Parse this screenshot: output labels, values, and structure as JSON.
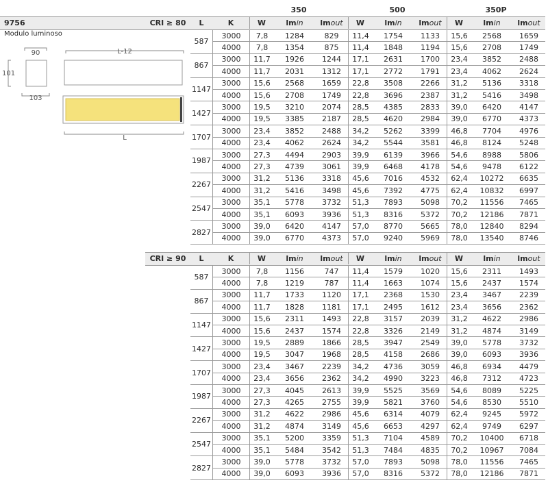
{
  "product_code": "9756",
  "subtitle": "Modulo luminoso",
  "drawing": {
    "width_label": "90",
    "height_label": "101",
    "depth_label": "103",
    "length_minus_label": "L-12",
    "length_label": "L",
    "fill_color": "#f5e27c"
  },
  "currents": [
    "350",
    "500",
    "350P"
  ],
  "table1": {
    "cri_label": "CRI ≥ 80",
    "col_L": "L",
    "col_K": "K",
    "sub_headers": [
      "W",
      "lm",
      "in",
      "lm",
      "out"
    ],
    "groups": [
      {
        "L": "587",
        "rows": [
          [
            "3000",
            "7,8",
            "1284",
            "829",
            "11,4",
            "1754",
            "1133",
            "15,6",
            "2568",
            "1659"
          ],
          [
            "4000",
            "7,8",
            "1354",
            "875",
            "11,4",
            "1848",
            "1194",
            "15,6",
            "2708",
            "1749"
          ]
        ]
      },
      {
        "L": "867",
        "rows": [
          [
            "3000",
            "11,7",
            "1926",
            "1244",
            "17,1",
            "2631",
            "1700",
            "23,4",
            "3852",
            "2488"
          ],
          [
            "4000",
            "11,7",
            "2031",
            "1312",
            "17,1",
            "2772",
            "1791",
            "23,4",
            "4062",
            "2624"
          ]
        ]
      },
      {
        "L": "1147",
        "rows": [
          [
            "3000",
            "15,6",
            "2568",
            "1659",
            "22,8",
            "3508",
            "2266",
            "31,2",
            "5136",
            "3318"
          ],
          [
            "4000",
            "15,6",
            "2708",
            "1749",
            "22,8",
            "3696",
            "2387",
            "31,2",
            "5416",
            "3498"
          ]
        ]
      },
      {
        "L": "1427",
        "rows": [
          [
            "3000",
            "19,5",
            "3210",
            "2074",
            "28,5",
            "4385",
            "2833",
            "39,0",
            "6420",
            "4147"
          ],
          [
            "4000",
            "19,5",
            "3385",
            "2187",
            "28,5",
            "4620",
            "2984",
            "39,0",
            "6770",
            "4373"
          ]
        ]
      },
      {
        "L": "1707",
        "rows": [
          [
            "3000",
            "23,4",
            "3852",
            "2488",
            "34,2",
            "5262",
            "3399",
            "46,8",
            "7704",
            "4976"
          ],
          [
            "4000",
            "23,4",
            "4062",
            "2624",
            "34,2",
            "5544",
            "3581",
            "46,8",
            "8124",
            "5248"
          ]
        ]
      },
      {
        "L": "1987",
        "rows": [
          [
            "3000",
            "27,3",
            "4494",
            "2903",
            "39,9",
            "6139",
            "3966",
            "54,6",
            "8988",
            "5806"
          ],
          [
            "4000",
            "27,3",
            "4739",
            "3061",
            "39,9",
            "6468",
            "4178",
            "54,6",
            "9478",
            "6122"
          ]
        ]
      },
      {
        "L": "2267",
        "rows": [
          [
            "3000",
            "31,2",
            "5136",
            "3318",
            "45,6",
            "7016",
            "4532",
            "62,4",
            "10272",
            "6635"
          ],
          [
            "4000",
            "31,2",
            "5416",
            "3498",
            "45,6",
            "7392",
            "4775",
            "62,4",
            "10832",
            "6997"
          ]
        ]
      },
      {
        "L": "2547",
        "rows": [
          [
            "3000",
            "35,1",
            "5778",
            "3732",
            "51,3",
            "7893",
            "5098",
            "70,2",
            "11556",
            "7465"
          ],
          [
            "4000",
            "35,1",
            "6093",
            "3936",
            "51,3",
            "8316",
            "5372",
            "70,2",
            "12186",
            "7871"
          ]
        ]
      },
      {
        "L": "2827",
        "rows": [
          [
            "3000",
            "39,0",
            "6420",
            "4147",
            "57,0",
            "8770",
            "5665",
            "78,0",
            "12840",
            "8294"
          ],
          [
            "4000",
            "39,0",
            "6770",
            "4373",
            "57,0",
            "9240",
            "5969",
            "78,0",
            "13540",
            "8746"
          ]
        ]
      }
    ]
  },
  "table2": {
    "cri_label": "CRI ≥ 90",
    "col_L": "L",
    "col_K": "K",
    "groups": [
      {
        "L": "587",
        "rows": [
          [
            "3000",
            "7,8",
            "1156",
            "747",
            "11,4",
            "1579",
            "1020",
            "15,6",
            "2311",
            "1493"
          ],
          [
            "4000",
            "7,8",
            "1219",
            "787",
            "11,4",
            "1663",
            "1074",
            "15,6",
            "2437",
            "1574"
          ]
        ]
      },
      {
        "L": "867",
        "rows": [
          [
            "3000",
            "11,7",
            "1733",
            "1120",
            "17,1",
            "2368",
            "1530",
            "23,4",
            "3467",
            "2239"
          ],
          [
            "4000",
            "11,7",
            "1828",
            "1181",
            "17,1",
            "2495",
            "1612",
            "23,4",
            "3656",
            "2362"
          ]
        ]
      },
      {
        "L": "1147",
        "rows": [
          [
            "3000",
            "15,6",
            "2311",
            "1493",
            "22,8",
            "3157",
            "2039",
            "31,2",
            "4622",
            "2986"
          ],
          [
            "4000",
            "15,6",
            "2437",
            "1574",
            "22,8",
            "3326",
            "2149",
            "31,2",
            "4874",
            "3149"
          ]
        ]
      },
      {
        "L": "1427",
        "rows": [
          [
            "3000",
            "19,5",
            "2889",
            "1866",
            "28,5",
            "3947",
            "2549",
            "39,0",
            "5778",
            "3732"
          ],
          [
            "4000",
            "19,5",
            "3047",
            "1968",
            "28,5",
            "4158",
            "2686",
            "39,0",
            "6093",
            "3936"
          ]
        ]
      },
      {
        "L": "1707",
        "rows": [
          [
            "3000",
            "23,4",
            "3467",
            "2239",
            "34,2",
            "4736",
            "3059",
            "46,8",
            "6934",
            "4479"
          ],
          [
            "4000",
            "23,4",
            "3656",
            "2362",
            "34,2",
            "4990",
            "3223",
            "46,8",
            "7312",
            "4723"
          ]
        ]
      },
      {
        "L": "1987",
        "rows": [
          [
            "3000",
            "27,3",
            "4045",
            "2613",
            "39,9",
            "5525",
            "3569",
            "54,6",
            "8089",
            "5225"
          ],
          [
            "4000",
            "27,3",
            "4265",
            "2755",
            "39,9",
            "5821",
            "3760",
            "54,6",
            "8530",
            "5510"
          ]
        ]
      },
      {
        "L": "2267",
        "rows": [
          [
            "3000",
            "31,2",
            "4622",
            "2986",
            "45,6",
            "6314",
            "4079",
            "62,4",
            "9245",
            "5972"
          ],
          [
            "4000",
            "31,2",
            "4874",
            "3149",
            "45,6",
            "6653",
            "4297",
            "62,4",
            "9749",
            "6297"
          ]
        ]
      },
      {
        "L": "2547",
        "rows": [
          [
            "3000",
            "35,1",
            "5200",
            "3359",
            "51,3",
            "7104",
            "4589",
            "70,2",
            "10400",
            "6718"
          ],
          [
            "4000",
            "35,1",
            "5484",
            "3542",
            "51,3",
            "7484",
            "4835",
            "70,2",
            "10967",
            "7084"
          ]
        ]
      },
      {
        "L": "2827",
        "rows": [
          [
            "3000",
            "39,0",
            "5778",
            "3732",
            "57,0",
            "7893",
            "5098",
            "78,0",
            "11556",
            "7465"
          ],
          [
            "4000",
            "39,0",
            "6093",
            "3936",
            "57,0",
            "8316",
            "5372",
            "78,0",
            "12186",
            "7871"
          ]
        ]
      }
    ]
  }
}
